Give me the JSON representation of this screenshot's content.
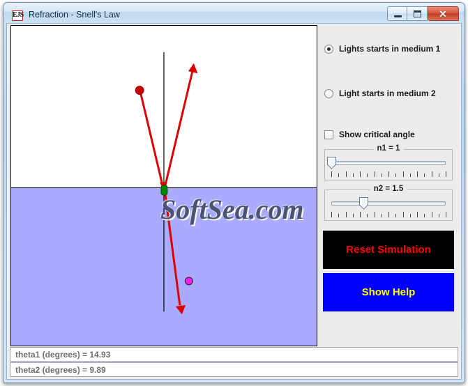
{
  "window": {
    "title": "Refraction - Snell's Law",
    "icon_label": "EJS",
    "icon_name": "ejs-app-icon",
    "buttons": {
      "minimize": "minimize",
      "maximize": "maximize",
      "close": "✕"
    }
  },
  "canvas": {
    "watermark": "SoftSea.com",
    "medium1_color": "#ffffff",
    "medium2_color": "#aaaaff",
    "ray_color": "#dd0000",
    "normal_color": "#000000",
    "source_dot_color": "#cc0000",
    "interface_marker_color": "#008800",
    "drag_dot_color": "#ee22ee",
    "elements": {
      "normal_line": "vertical normal line at interface",
      "incident_ray": "red ray from source dot down to interface",
      "reflected_ray": "red ray up-right from interface with arrowhead",
      "refracted_ray": "red ray down-right into medium 2 with arrowhead",
      "source_handle": "red draggable source dot",
      "interface_point": "green marker at interface",
      "medium2_handle": "magenta draggable dot in medium 2"
    }
  },
  "controls": {
    "radio_medium1": {
      "label": "Lights starts in medium 1",
      "selected": true
    },
    "radio_medium2": {
      "label": "Light starts in medium 2",
      "selected": false
    },
    "checkbox_critical_angle": {
      "label": "Show critical angle",
      "checked": false
    },
    "slider_n1": {
      "title": "n1 = 1",
      "value_percent": 0,
      "tick_count": 17
    },
    "slider_n2": {
      "title": "n2 = 1.5",
      "value_percent": 28,
      "tick_count": 17
    },
    "reset_button": {
      "label": "Reset Simulation",
      "background": "#000000",
      "color": "#ff0000"
    },
    "help_button": {
      "label": "Show Help",
      "background": "#0000ff",
      "color": "#ffff00"
    }
  },
  "status": {
    "theta1": "theta1 (degrees) = 14.93",
    "theta2": "theta2 (degrees) = 9.89"
  }
}
